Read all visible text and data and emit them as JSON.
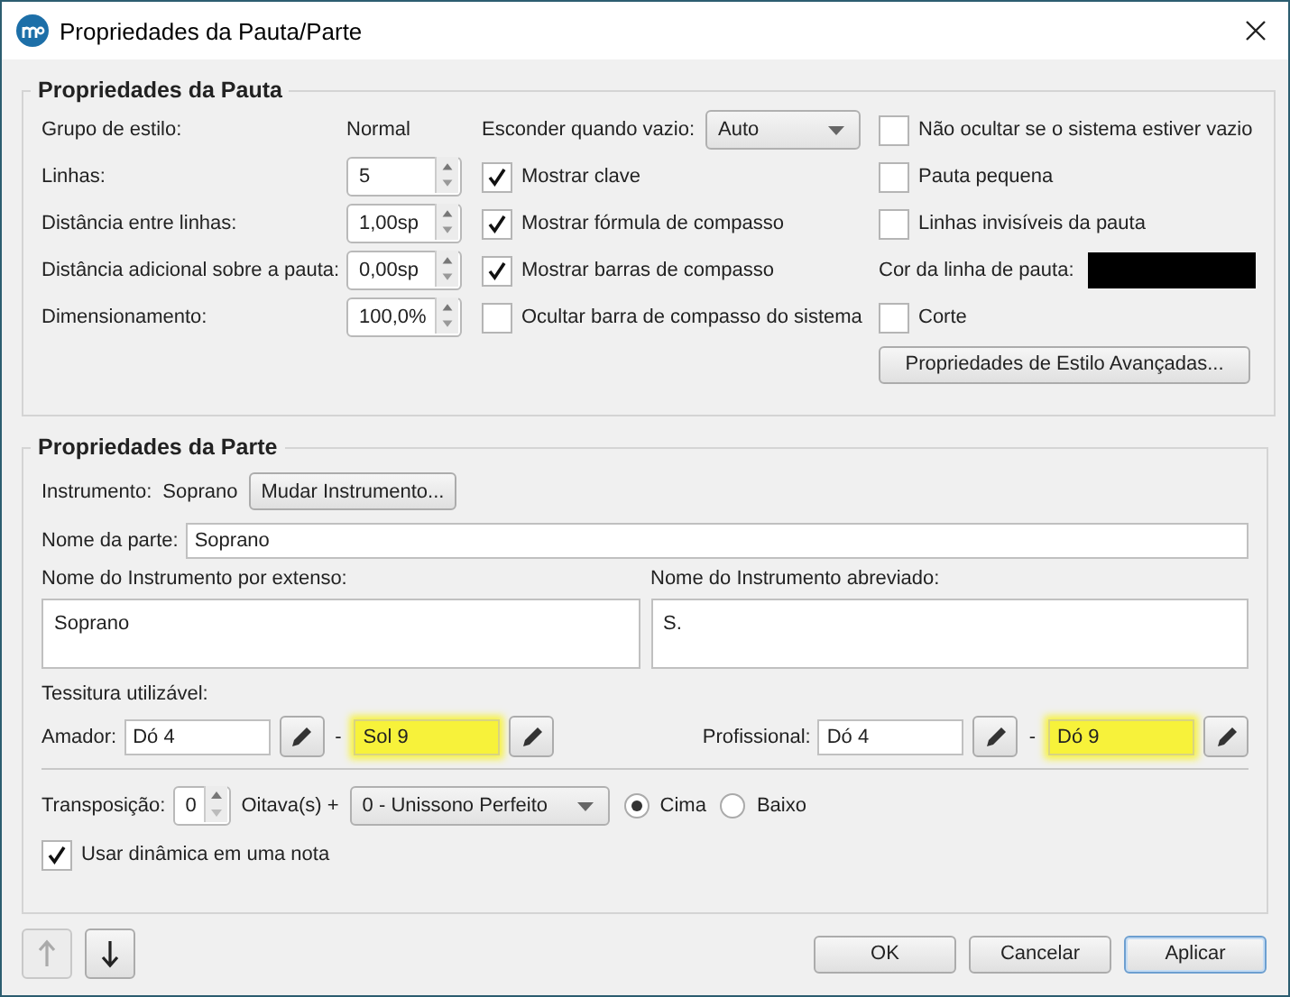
{
  "window": {
    "title": "Propriedades da Pauta/Parte"
  },
  "staff_properties": {
    "title": "Propriedades da Pauta",
    "style_group": {
      "label": "Grupo de estilo:",
      "value": "Normal"
    },
    "spinboxes": [
      {
        "label": "Linhas:",
        "value": "5"
      },
      {
        "label": "Distância entre linhas:",
        "value": "1,00sp"
      },
      {
        "label": "Distância adicional sobre a pauta:",
        "value": "0,00sp"
      },
      {
        "label": "Dimensionamento:",
        "value": "100,0%"
      }
    ],
    "hide_when_empty": {
      "label": "Esconder quando vazio:",
      "value": "Auto"
    },
    "middle_checkboxes": [
      {
        "label": "Mostrar clave",
        "checked": true
      },
      {
        "label": "Mostrar fórmula de compasso",
        "checked": true
      },
      {
        "label": "Mostrar barras de compasso",
        "checked": true
      },
      {
        "label": "Ocultar barra de compasso do sistema",
        "checked": false
      }
    ],
    "right_items": [
      {
        "kind": "checkbox",
        "label": "Não ocultar se o sistema estiver vazio",
        "checked": false
      },
      {
        "kind": "checkbox",
        "label": "Pauta pequena",
        "checked": false
      },
      {
        "kind": "checkbox",
        "label": "Linhas invisíveis da pauta",
        "checked": false
      },
      {
        "kind": "color",
        "label": "Cor da linha de pauta:",
        "color": "#000000"
      },
      {
        "kind": "checkbox",
        "label": "Corte",
        "checked": false
      },
      {
        "kind": "button",
        "label": "Propriedades de Estilo Avançadas..."
      }
    ]
  },
  "part_properties": {
    "title": "Propriedades da Parte",
    "instrument": {
      "label": "Instrumento:",
      "value": "Soprano",
      "button": "Mudar Instrumento..."
    },
    "part_name": {
      "label": "Nome da parte:",
      "value": "Soprano"
    },
    "long_name": {
      "label": "Nome do Instrumento por extenso:",
      "value": "Soprano"
    },
    "short_name": {
      "label": "Nome do Instrumento abreviado:",
      "value": "S."
    },
    "range_label": "Tessitura utilizável:",
    "ranges": [
      {
        "label": "Amador:",
        "low": {
          "value": "Dó 4",
          "highlighted": false
        },
        "separator": "-",
        "high": {
          "value": "Sol 9",
          "highlighted": true
        }
      },
      {
        "label": "Profissional:",
        "low": {
          "value": "Dó 4",
          "highlighted": false
        },
        "separator": "-",
        "high": {
          "value": "Dó 9",
          "highlighted": true
        }
      }
    ],
    "transposition": {
      "label": "Transposição:",
      "octaves": "0",
      "octaves_label": "Oitava(s) +",
      "interval": "0 - Unissono Perfeito",
      "directions": [
        {
          "label": "Cima",
          "selected": true
        },
        {
          "label": "Baixo",
          "selected": false
        }
      ]
    },
    "single_note_dynamics": {
      "label": "Usar dinâmica em uma nota",
      "checked": true
    }
  },
  "footer": {
    "arrows": [
      {
        "kind": "up",
        "disabled": true
      },
      {
        "kind": "down",
        "disabled": false
      }
    ],
    "buttons": [
      {
        "label": "OK",
        "default": false
      },
      {
        "label": "Cancelar",
        "default": false
      },
      {
        "label": "Aplicar",
        "default": true
      }
    ]
  }
}
